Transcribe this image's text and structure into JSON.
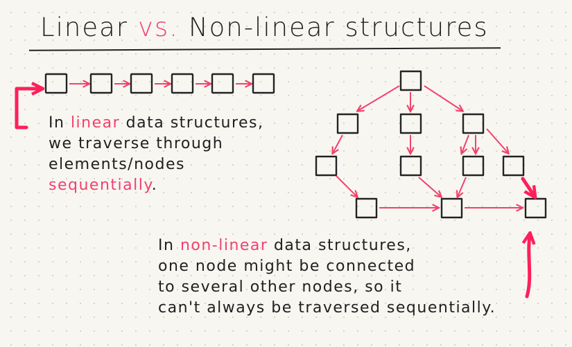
{
  "title": {
    "linear": "Linear",
    "vs": "vs.",
    "nonlinear": "Non-linear structures"
  },
  "linear_note": {
    "line1_pre": "In ",
    "line1_highlight": "linear",
    "line1_post": " data structures,",
    "line2": "we traverse through",
    "line3": "elements/nodes",
    "line4_highlight": "sequentially",
    "line4_post": "."
  },
  "nonlinear_note": {
    "line1_pre": "In ",
    "line1_highlight": "non-linear",
    "line1_post": " data structures,",
    "line2": "one node might be connected",
    "line3": "to several other nodes, so it",
    "line4": "can't always be traversed sequentially."
  },
  "colors": {
    "ink": "#202020",
    "accent_pink": "#f2416b",
    "accent_red": "#ff1f5a",
    "paper": "#f7f6f1"
  }
}
